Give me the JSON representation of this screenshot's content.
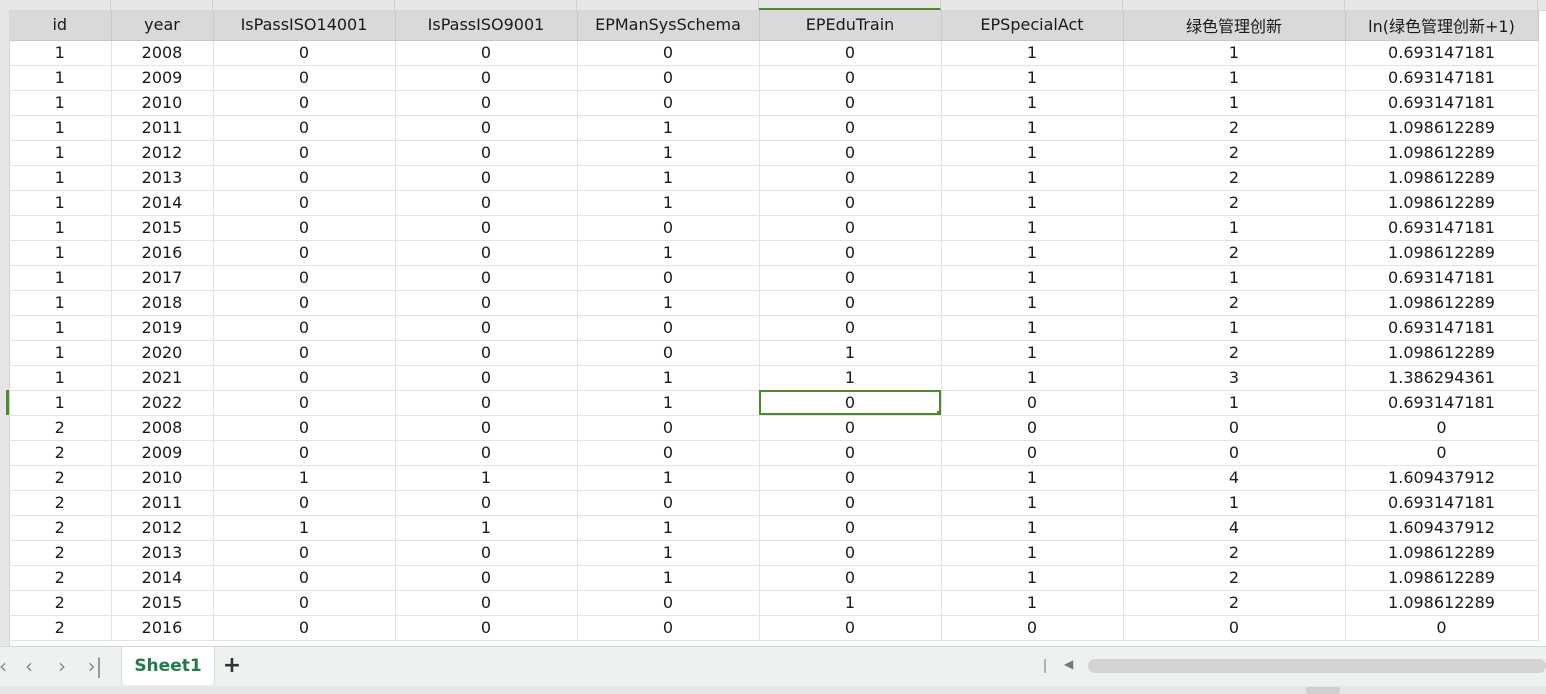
{
  "headers": [
    "id",
    "year",
    "IsPassISO14001",
    "IsPassISO9001",
    "EPManSysSchema",
    "EPEduTrain",
    "EPSpecialAct",
    "绿色管理创新",
    "ln(绿色管理创新+1)"
  ],
  "rows": [
    [
      "1",
      "2008",
      "0",
      "0",
      "0",
      "0",
      "1",
      "1",
      "0.693147181"
    ],
    [
      "1",
      "2009",
      "0",
      "0",
      "0",
      "0",
      "1",
      "1",
      "0.693147181"
    ],
    [
      "1",
      "2010",
      "0",
      "0",
      "0",
      "0",
      "1",
      "1",
      "0.693147181"
    ],
    [
      "1",
      "2011",
      "0",
      "0",
      "1",
      "0",
      "1",
      "2",
      "1.098612289"
    ],
    [
      "1",
      "2012",
      "0",
      "0",
      "1",
      "0",
      "1",
      "2",
      "1.098612289"
    ],
    [
      "1",
      "2013",
      "0",
      "0",
      "1",
      "0",
      "1",
      "2",
      "1.098612289"
    ],
    [
      "1",
      "2014",
      "0",
      "0",
      "1",
      "0",
      "1",
      "2",
      "1.098612289"
    ],
    [
      "1",
      "2015",
      "0",
      "0",
      "0",
      "0",
      "1",
      "1",
      "0.693147181"
    ],
    [
      "1",
      "2016",
      "0",
      "0",
      "1",
      "0",
      "1",
      "2",
      "1.098612289"
    ],
    [
      "1",
      "2017",
      "0",
      "0",
      "0",
      "0",
      "1",
      "1",
      "0.693147181"
    ],
    [
      "1",
      "2018",
      "0",
      "0",
      "1",
      "0",
      "1",
      "2",
      "1.098612289"
    ],
    [
      "1",
      "2019",
      "0",
      "0",
      "0",
      "0",
      "1",
      "1",
      "0.693147181"
    ],
    [
      "1",
      "2020",
      "0",
      "0",
      "0",
      "1",
      "1",
      "2",
      "1.098612289"
    ],
    [
      "1",
      "2021",
      "0",
      "0",
      "1",
      "1",
      "1",
      "3",
      "1.386294361"
    ],
    [
      "1",
      "2022",
      "0",
      "0",
      "1",
      "0",
      "0",
      "1",
      "0.693147181"
    ],
    [
      "2",
      "2008",
      "0",
      "0",
      "0",
      "0",
      "0",
      "0",
      "0"
    ],
    [
      "2",
      "2009",
      "0",
      "0",
      "0",
      "0",
      "0",
      "0",
      "0"
    ],
    [
      "2",
      "2010",
      "1",
      "1",
      "1",
      "0",
      "1",
      "4",
      "1.609437912"
    ],
    [
      "2",
      "2011",
      "0",
      "0",
      "0",
      "0",
      "1",
      "1",
      "0.693147181"
    ],
    [
      "2",
      "2012",
      "1",
      "1",
      "1",
      "0",
      "1",
      "4",
      "1.609437912"
    ],
    [
      "2",
      "2013",
      "0",
      "0",
      "1",
      "0",
      "1",
      "2",
      "1.098612289"
    ],
    [
      "2",
      "2014",
      "0",
      "0",
      "1",
      "0",
      "1",
      "2",
      "1.098612289"
    ],
    [
      "2",
      "2015",
      "0",
      "0",
      "0",
      "1",
      "1",
      "2",
      "1.098612289"
    ],
    [
      "2",
      "2016",
      "0",
      "0",
      "0",
      "0",
      "0",
      "0",
      "0"
    ]
  ],
  "selected_cell": {
    "row": 14,
    "col": 5
  },
  "sheet_tabs": [
    {
      "label": "Sheet1",
      "active": true
    }
  ],
  "colors": {
    "accent": "#4e8a2b",
    "tab_text": "#1e7b4e"
  }
}
